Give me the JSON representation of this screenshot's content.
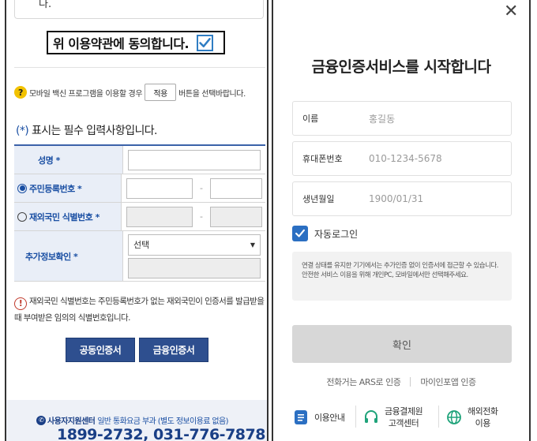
{
  "left": {
    "terms_tail_text": "다.",
    "agree_label": "위 이용약관에 동의합니다.",
    "agree_checked": true,
    "vaccine_notice": {
      "before": "모바일 백신 프로그램을 이용할 경우",
      "button": "적용",
      "after": "버튼을 선택바랍니다."
    },
    "required_note": {
      "star": "(*)",
      "text": " 표시는 필수 입력사항입니다."
    },
    "form": {
      "name_label": "성명 *",
      "resident_label": "주민등록번호 *",
      "foreigner_label": "재외국민 식별번호 *",
      "extra_label": "추가정보확인 *",
      "dash": "-",
      "select_value": "선택",
      "selected_radio": "resident"
    },
    "notice": "재외국민 식별번호는 주민등록번호가 없는 재외국민이 인증서를 발급받을 때 부여받은 임의의 식별번호입니다.",
    "buttons": {
      "joint_cert": "공동인증서",
      "financial_cert": "금융인증서"
    },
    "support": {
      "center": "사용자지원센터",
      "sub": "일반 통화요금 부과 (별도 정보이용료 없음)",
      "phone": "1899-2732, 031-776-7878"
    }
  },
  "right": {
    "close_label": "✕",
    "title": "금융인증서비스를 시작합니다",
    "fields": [
      {
        "label": "이름",
        "value": "홍길동"
      },
      {
        "label": "휴대폰번호",
        "value": "010-1234-5678"
      },
      {
        "label": "생년월일",
        "value": "1900/01/31"
      }
    ],
    "auto_login_label": "자동로그인",
    "auto_login_checked": true,
    "info_text": "연결 상태를 유지한 기기에서는 추가인증 없이 인증서에 접근할 수 있습니다. 안전한 서비스 이용을 위해 개인PC, 모바일에서만 선택해주세요.",
    "confirm_label": "확인",
    "alt_links": [
      "전화거는 ARS로 인증",
      "마이인포앱 인증"
    ],
    "bottom_links": [
      {
        "icon": "document-icon",
        "label": "이용안내"
      },
      {
        "icon": "headset-icon",
        "label": "금융결제원\n고객센터"
      },
      {
        "icon": "globe-icon",
        "label": "해외전화\n이용"
      }
    ],
    "colors": {
      "primary": "#2b6fc2",
      "navy": "#2e4f8f",
      "confirm_disabled": "#d7d7d7"
    }
  }
}
